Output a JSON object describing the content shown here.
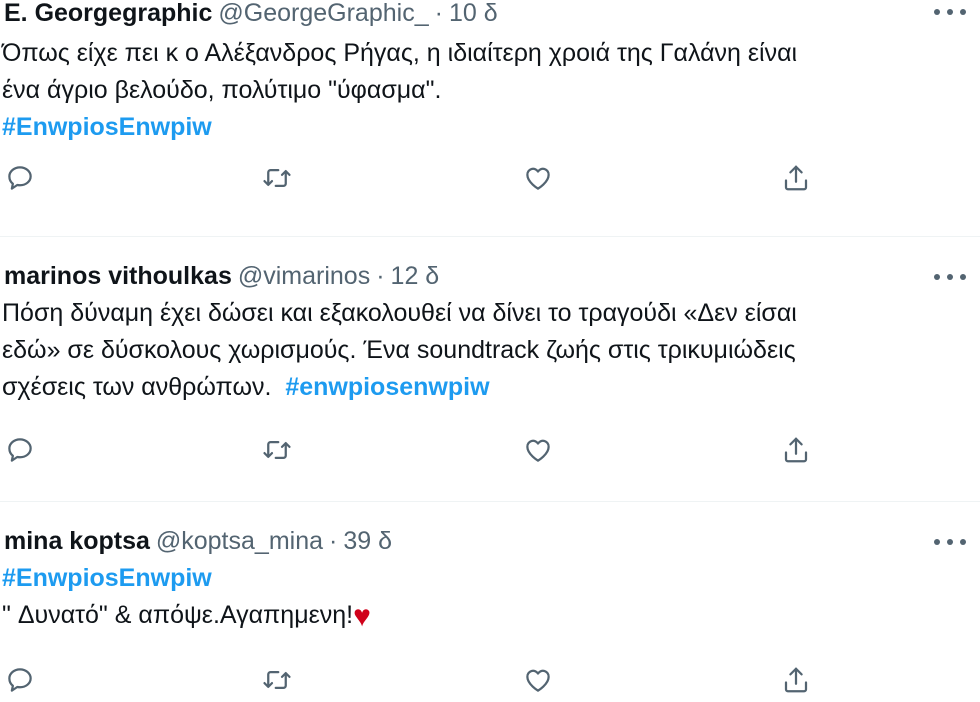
{
  "tweets": [
    {
      "name": "E. Georgegraphic",
      "handle": "@GeorgeGraphic_",
      "separator": "·",
      "time": "10 δ",
      "text": "Όπως είχε πει κ ο Αλέξανδρος Ρήγας, η ιδιαίτερη χροιά της Γαλάνη είναι\nένα άγριο βελούδο, πολύτιμο \"ύφασμα\".",
      "hashtag": "#EnwpiosEnwpiw"
    },
    {
      "name": "marinos vithoulkas",
      "handle": "@vimarinos",
      "separator": "·",
      "time": "12 δ",
      "text": "Πόση δύναμη έχει δώσει και εξακολουθεί να δίνει το τραγούδι «Δεν είσαι\nεδώ» σε δύσκολους χωρισμούς. Ένα soundtrack ζωής στις τρικυμιώδεις\nσχέσεις των ανθρώπων.  ",
      "hashtag": "#enwpiosenwpiw"
    },
    {
      "name": "mina koptsa",
      "handle": "@koptsa_mina",
      "separator": "·",
      "time": "39 δ",
      "hashtag": "#EnwpiosEnwpiw",
      "text": "\" Δυνατό\" & απόψε.Αγαπημενη!",
      "emoji": "♥"
    }
  ],
  "icons": {
    "reply": "reply-icon",
    "retweet": "retweet-icon",
    "like": "like-icon",
    "share": "share-icon",
    "more": "more-icon"
  },
  "colors": {
    "link": "#1d9bf0",
    "secondary": "#536471",
    "heart": "#d0021b"
  }
}
